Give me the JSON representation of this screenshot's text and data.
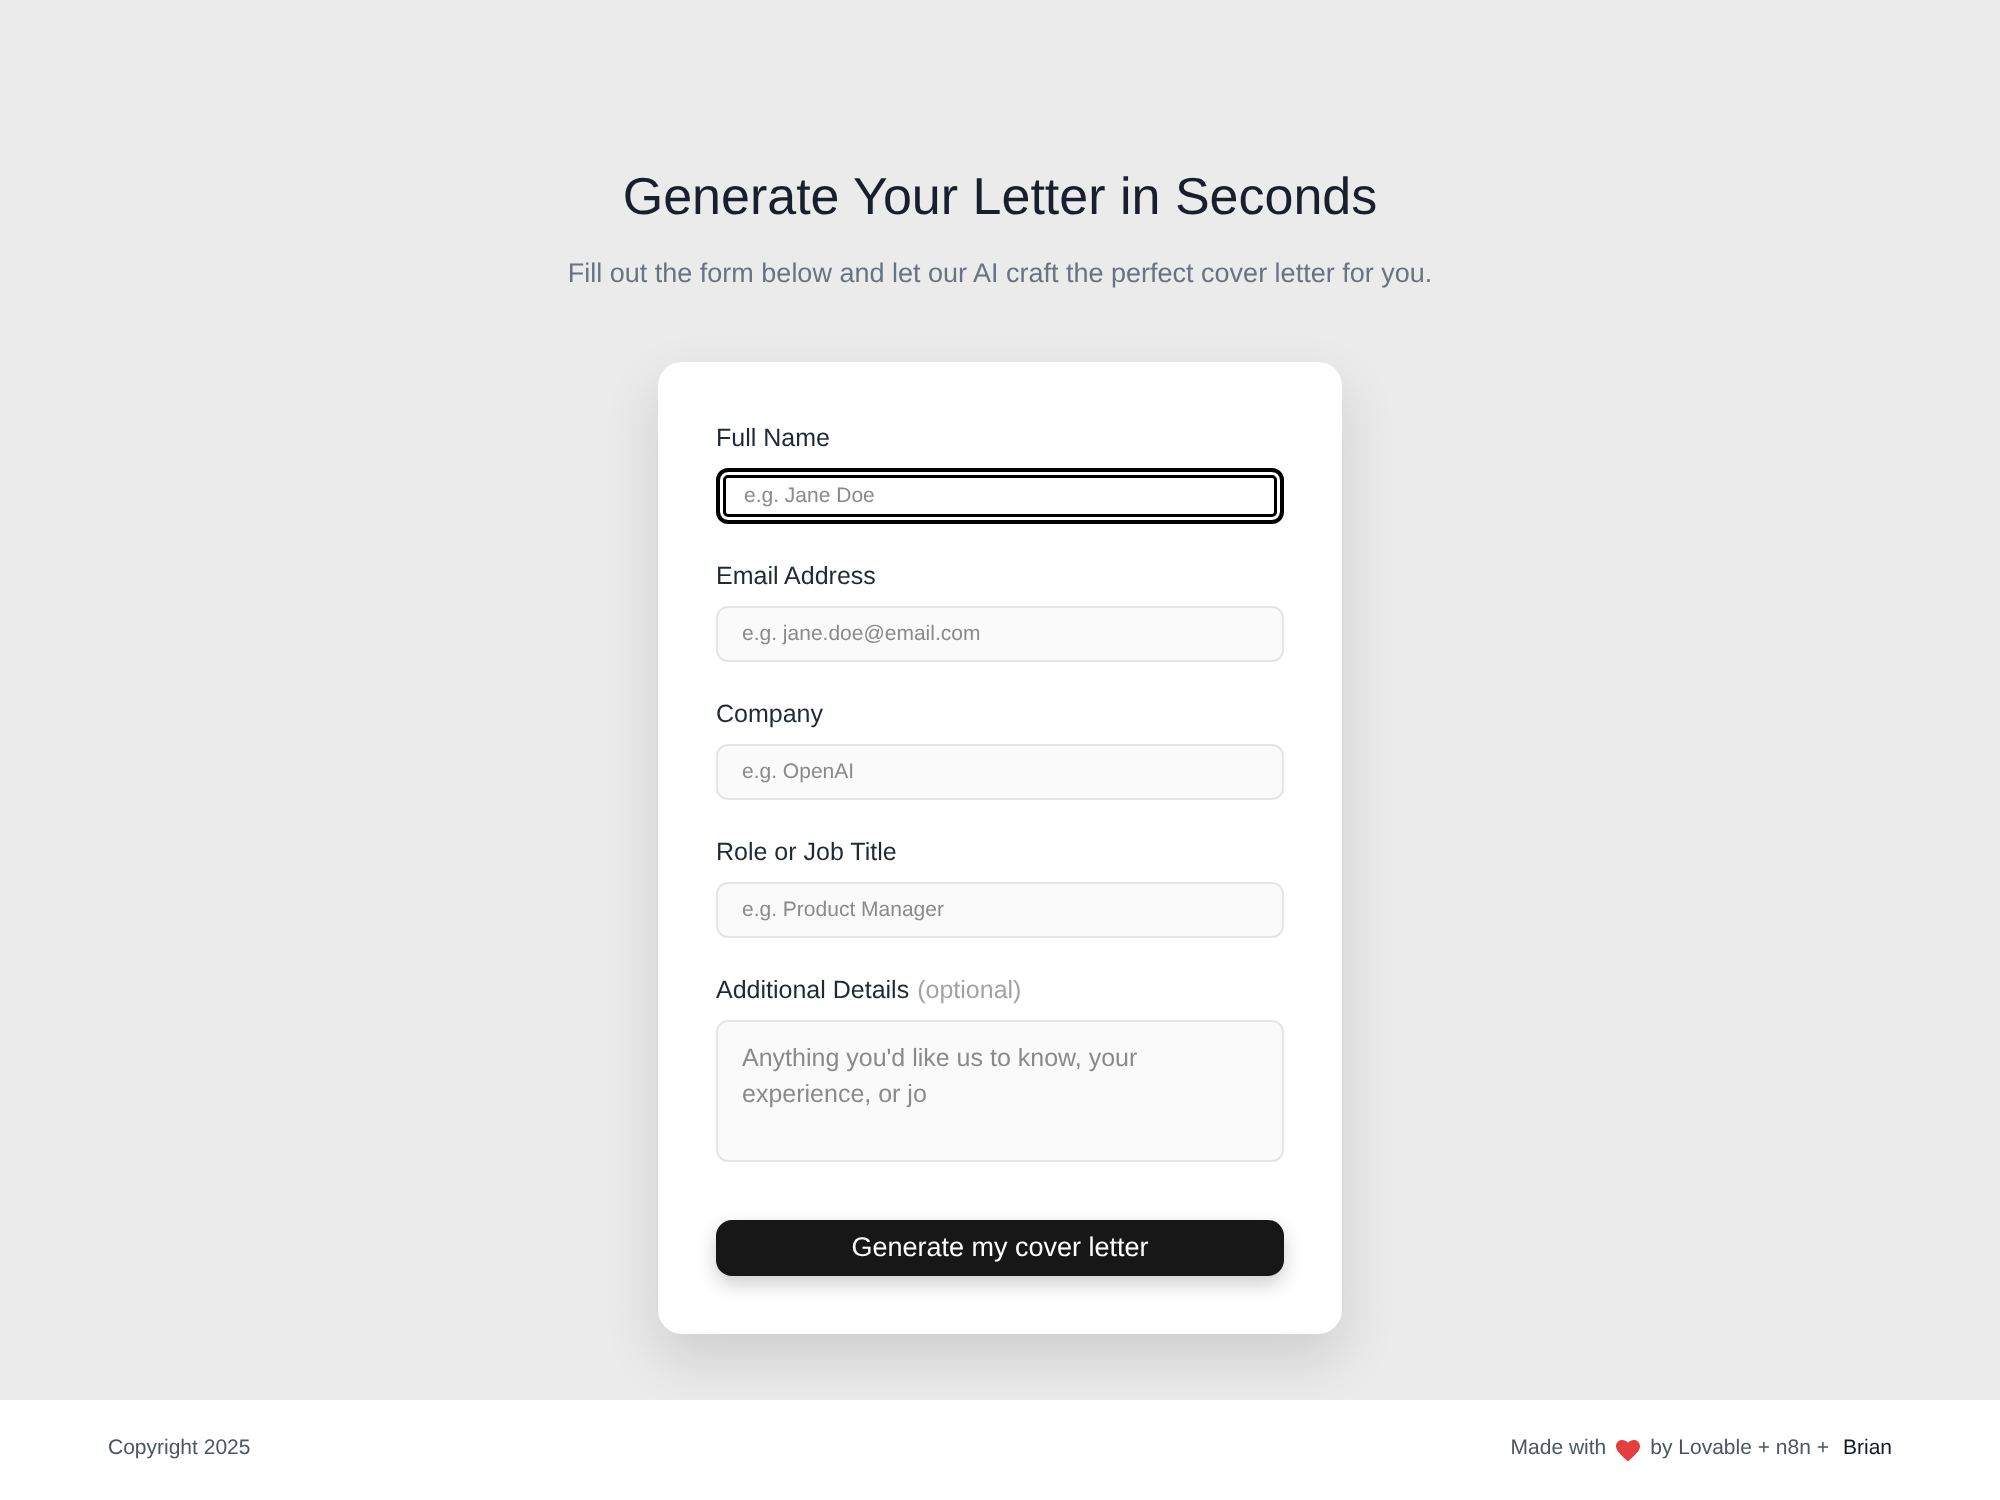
{
  "header": {
    "title": "Generate Your Letter in Seconds",
    "subtitle": "Fill out the form below and let our AI craft the perfect cover letter for you."
  },
  "form": {
    "fields": [
      {
        "kind": "input",
        "label": "Full Name",
        "placeholder": "e.g. Jane Doe",
        "focused": true
      },
      {
        "kind": "input",
        "label": "Email Address",
        "placeholder": "e.g. jane.doe@email.com",
        "focused": false
      },
      {
        "kind": "input",
        "label": "Company",
        "placeholder": "e.g. OpenAI",
        "focused": false
      },
      {
        "kind": "input",
        "label": "Role or Job Title",
        "placeholder": "e.g. Product Manager",
        "focused": false
      },
      {
        "kind": "textarea",
        "label": "Additional Details",
        "hint": "(optional)",
        "placeholder": "Anything you'd like us to know, your experience, or jo",
        "focused": false
      }
    ],
    "submit_button": "Generate my cover letter"
  },
  "footer": {
    "copyright": "Copyright 2025",
    "credit_prefix": "Made with",
    "credit_suffix": "by Lovable + n8n +",
    "credit_link": "Brian"
  }
}
